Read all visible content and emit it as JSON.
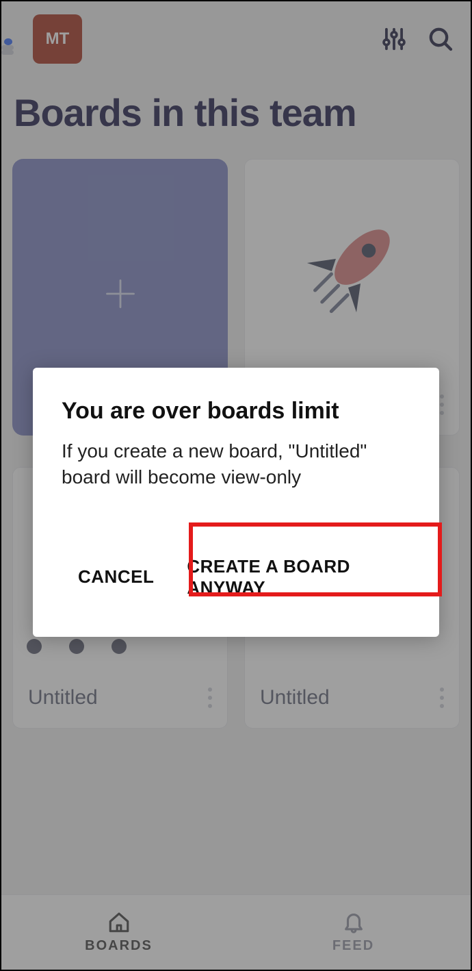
{
  "header": {
    "team_initials": "MT"
  },
  "page": {
    "title": "Boards in this team"
  },
  "boards": [
    {
      "title": "Untitled"
    },
    {
      "title": "Untitled"
    },
    {
      "title": "Untitled"
    }
  ],
  "nav": {
    "boards_label": "BOARDS",
    "feed_label": "FEED"
  },
  "dialog": {
    "title": "You are over boards limit",
    "body": "If you create a new board, \"Untitled\" board will become view-only",
    "cancel_label": "CANCEL",
    "create_label": "CREATE A BOARD ANYWAY"
  }
}
